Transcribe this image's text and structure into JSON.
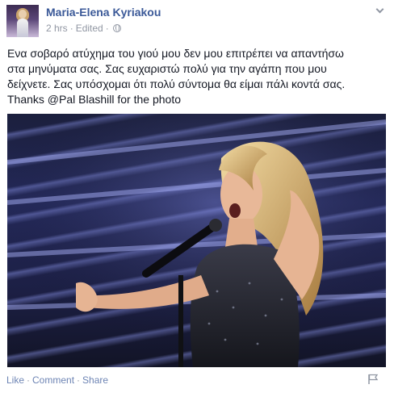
{
  "post": {
    "author": "Maria-Elena Kyriakou",
    "time": "2 hrs",
    "edited": "Edited",
    "separator": "·",
    "privacy_icon": "globe-icon",
    "menu_icon": "chevron-down-icon",
    "text_lines": [
      "Ενα σοβαρό ατύχημα του γιού μου δεν μου επιτρέπει να απαντήσω",
      "στα μηνύματα σας. Σας ευχαριστώ πολύ για την αγάπη που μου",
      "δείχνετε. Σας υπόσχομαι ότι πολύ σύντομα θα είμαι πάλι κοντά σας.",
      "Thanks @Pal Blashill for the photo"
    ],
    "actions": {
      "like": "Like",
      "comment": "Comment",
      "share": "Share",
      "separator": "·"
    },
    "flag_icon": "flag-icon"
  },
  "colors": {
    "name_link": "#3b5998",
    "action_link": "#6d84b4",
    "meta_gray": "#9197a3"
  }
}
